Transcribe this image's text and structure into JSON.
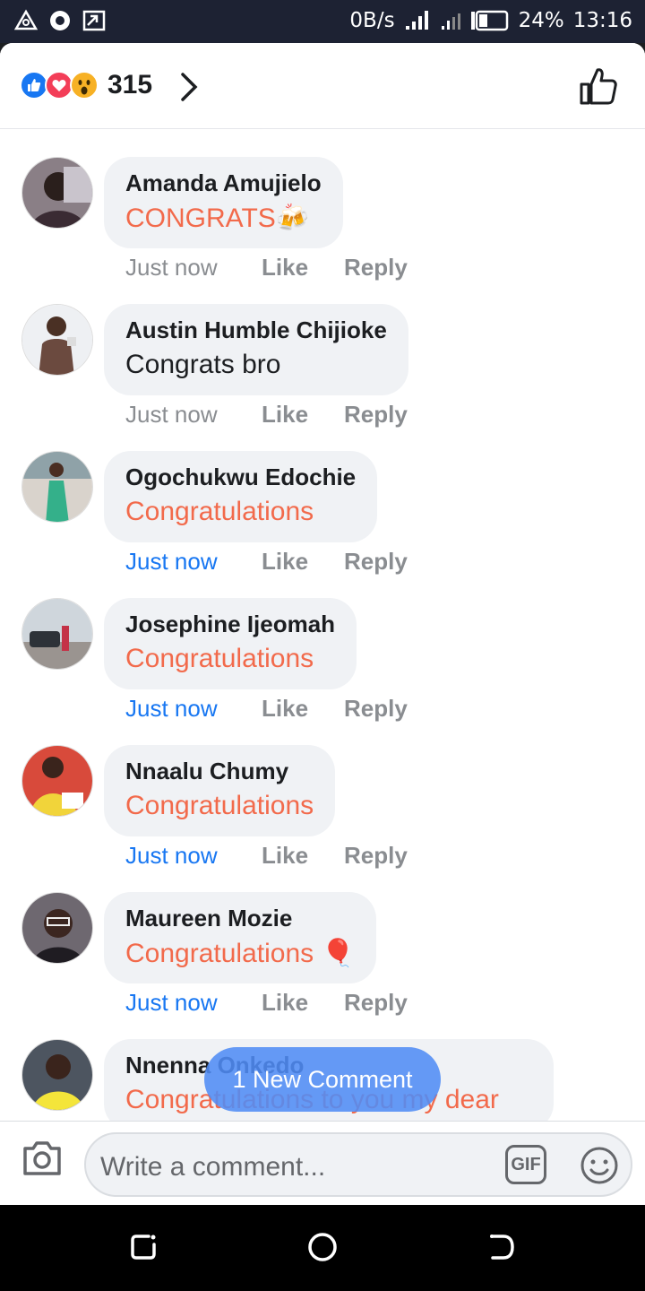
{
  "status_bar": {
    "speed": "0B/s",
    "battery": "24%",
    "time": "13:16"
  },
  "header": {
    "reaction_count": "315",
    "icons": [
      "like-reaction-icon",
      "love-reaction-icon",
      "wow-reaction-icon",
      "chevron-right-icon",
      "thumbs-up-icon"
    ]
  },
  "partial_reply": "Reply",
  "comments": [
    {
      "name": "Amanda Amujielo",
      "text": "CONGRATS🍻",
      "time": "Just now",
      "like": "Like",
      "reply": "Reply"
    },
    {
      "name": "Austin Humble Chijioke",
      "text": "Congrats bro",
      "time": "Just now",
      "like": "Like",
      "reply": "Reply"
    },
    {
      "name": "Ogochukwu Edochie",
      "text": "Congratulations",
      "time": "Just now",
      "like": "Like",
      "reply": "Reply"
    },
    {
      "name": "Josephine Ijeomah",
      "text": "Congratulations",
      "time": "Just now",
      "like": "Like",
      "reply": "Reply"
    },
    {
      "name": "Nnaalu Chumy",
      "text": "Congratulations",
      "time": "Just now",
      "like": "Like",
      "reply": "Reply"
    },
    {
      "name": "Maureen Mozie",
      "text": "Congratulations 🎈",
      "time": "Just now",
      "like": "Like",
      "reply": "Reply"
    },
    {
      "name": "Nnenna Onkedo",
      "text": "Congratulations to you my dear"
    }
  ],
  "new_comment_pill": "1 New Comment",
  "composer": {
    "placeholder": "Write a comment...",
    "gif_label": "GIF"
  },
  "colors": {
    "accent": "#1877f2",
    "highlight_text": "#f26a4b",
    "bubble": "#f0f2f5"
  }
}
